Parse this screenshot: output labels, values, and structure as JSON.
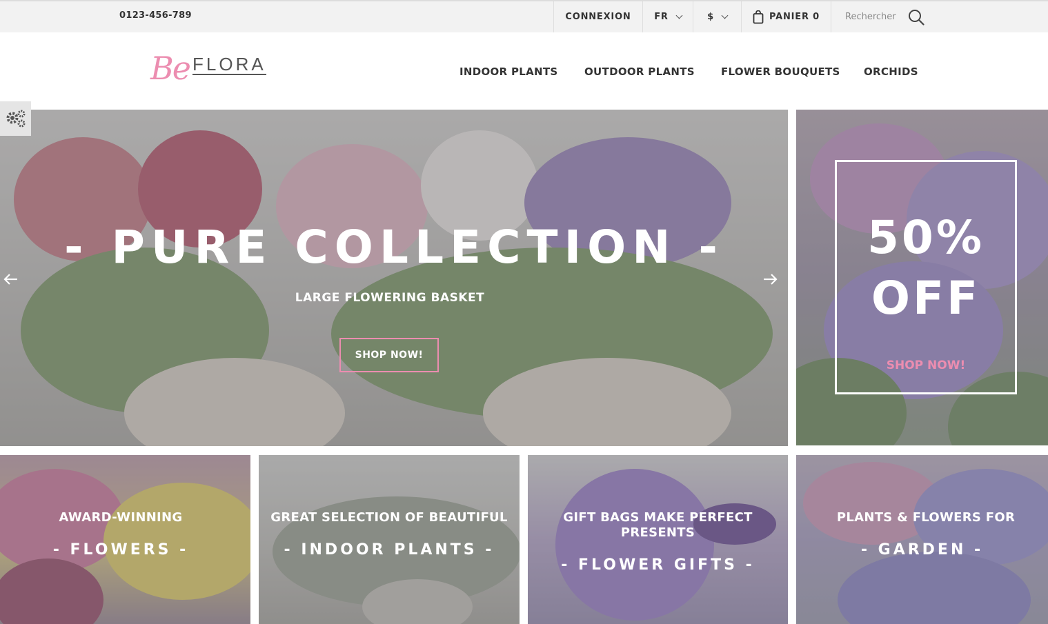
{
  "topbar": {
    "phone": "0123-456-789",
    "login": "CONNEXION",
    "language": "FR",
    "currency": "$",
    "cart": "PANIER 0",
    "search_placeholder": "Rechercher"
  },
  "header": {
    "logo_be": "Be",
    "logo_flora": "FLORA",
    "nav": [
      "INDOOR PLANTS",
      "OUTDOOR PLANTS",
      "FLOWER BOUQUETS",
      "ORCHIDS"
    ]
  },
  "hero": {
    "title": "- PURE COLLECTION -",
    "subtitle": "LARGE FLOWERING BASKET",
    "button": "SHOP NOW!"
  },
  "promo": {
    "line1": "50%",
    "line2": "OFF",
    "button": "SHOP NOW!"
  },
  "tiles": [
    {
      "top": "AWARD-WINNING",
      "main": "- FLOWERS -"
    },
    {
      "top": "GREAT SELECTION OF BEAUTIFUL",
      "main": "- INDOOR PLANTS -"
    },
    {
      "top": "GIFT BAGS MAKE PERFECT PRESENTS",
      "main": "- FLOWER GIFTS -"
    },
    {
      "top": "PLANTS & FLOWERS FOR",
      "main": "- GARDEN  -"
    }
  ],
  "colors": {
    "accent_pink": "#ec8db0",
    "topbar_bg": "#f2f2f2",
    "text_dark": "#333333"
  },
  "icons": {
    "cart": "shopping-bag-icon",
    "search": "magnifier-icon",
    "settings": "gears-icon",
    "prev": "arrow-left-icon",
    "next": "arrow-right-icon"
  }
}
